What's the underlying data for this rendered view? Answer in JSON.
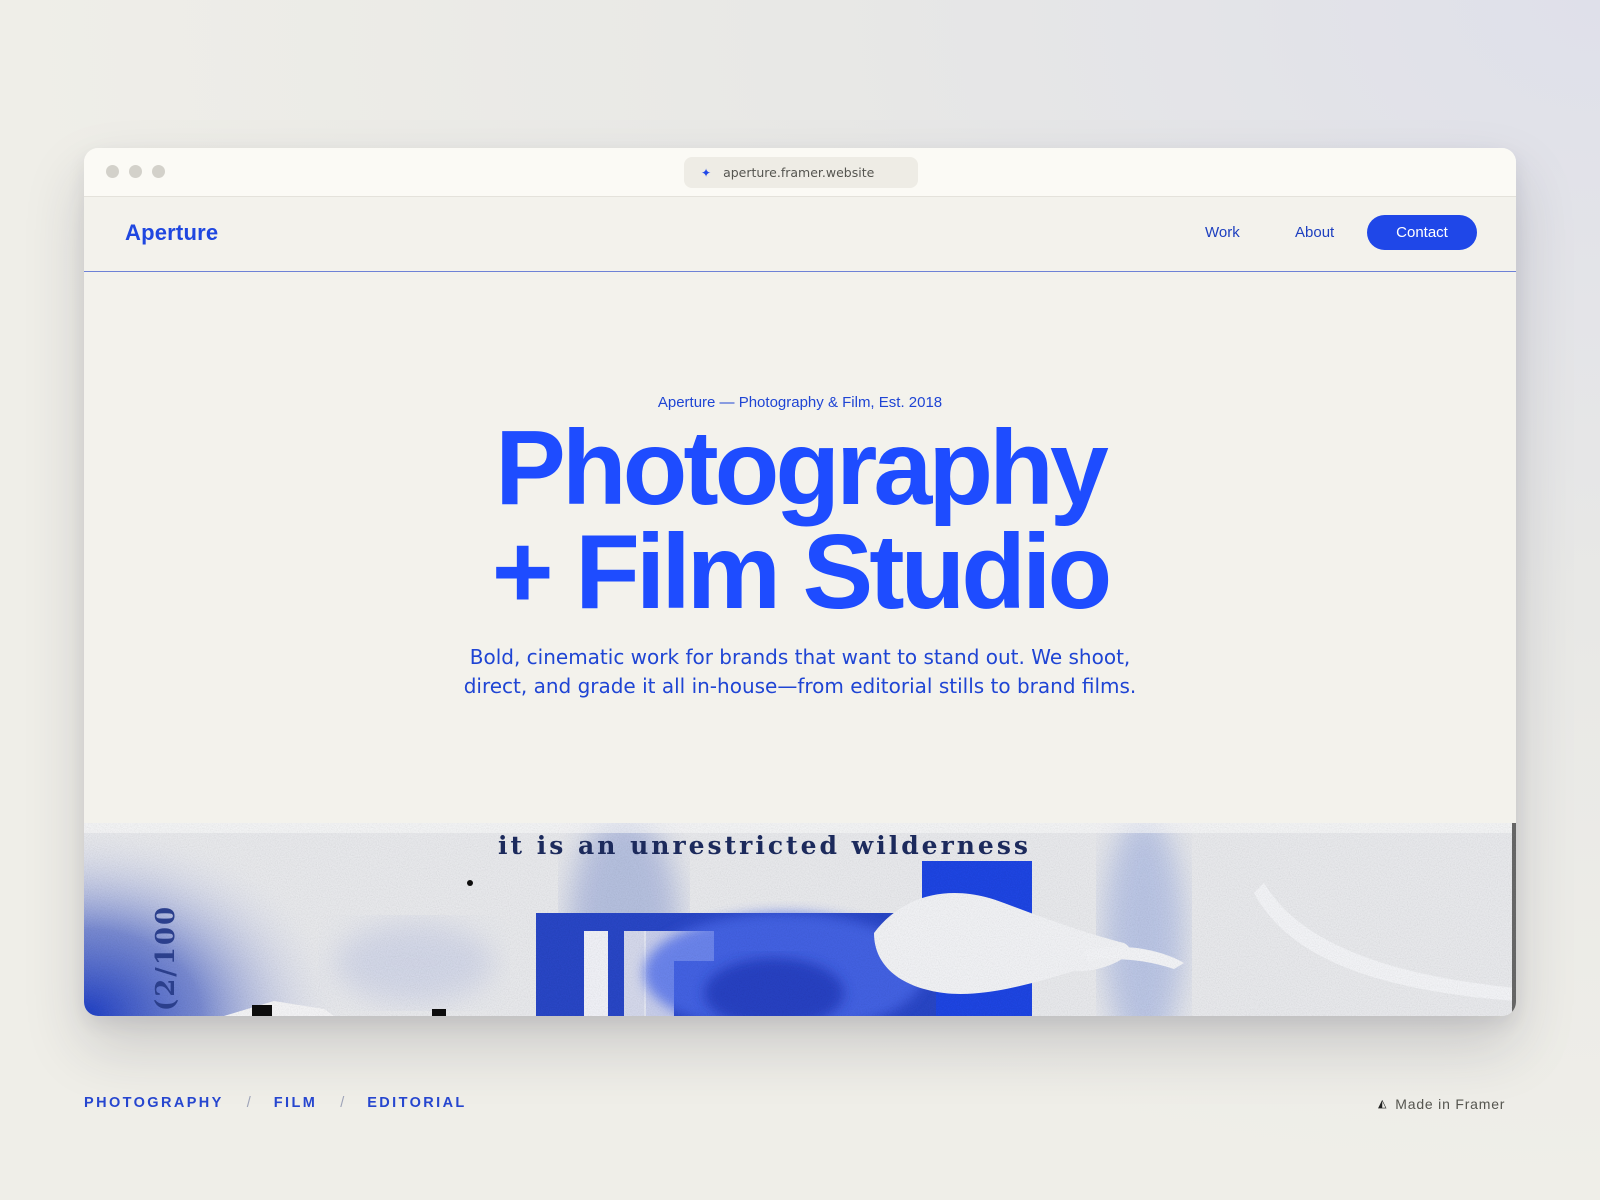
{
  "browser": {
    "url": "aperture.framer.website",
    "url_icon": "framer-sparkle-icon"
  },
  "nav": {
    "logo": "Aperture",
    "links": [
      {
        "label": "Work"
      },
      {
        "label": "About"
      }
    ],
    "cta": "Contact"
  },
  "hero": {
    "eyebrow": "Aperture — Photography & Film, Est. 2018",
    "headline_line1": "Photography",
    "headline_line2": "+ Film Studio",
    "subtext_line1": "Bold, cinematic work for brands that want to stand out. We shoot,",
    "subtext_line2": "direct, and grade it all in-house—from editorial stills to brand films.",
    "art_caption": "it is an unrestricted wilderness",
    "art_counter": "(2/100"
  },
  "footer": {
    "tags": [
      "PHOTOGRAPHY",
      "FILM",
      "EDITORIAL"
    ],
    "separator": "/",
    "badge": "Made in Framer",
    "badge_icon": "framer-triangle-icon"
  },
  "colors": {
    "accent": "#1e4cff",
    "text_blue": "#1f45d4",
    "page_bg": "#f3f2ec"
  }
}
